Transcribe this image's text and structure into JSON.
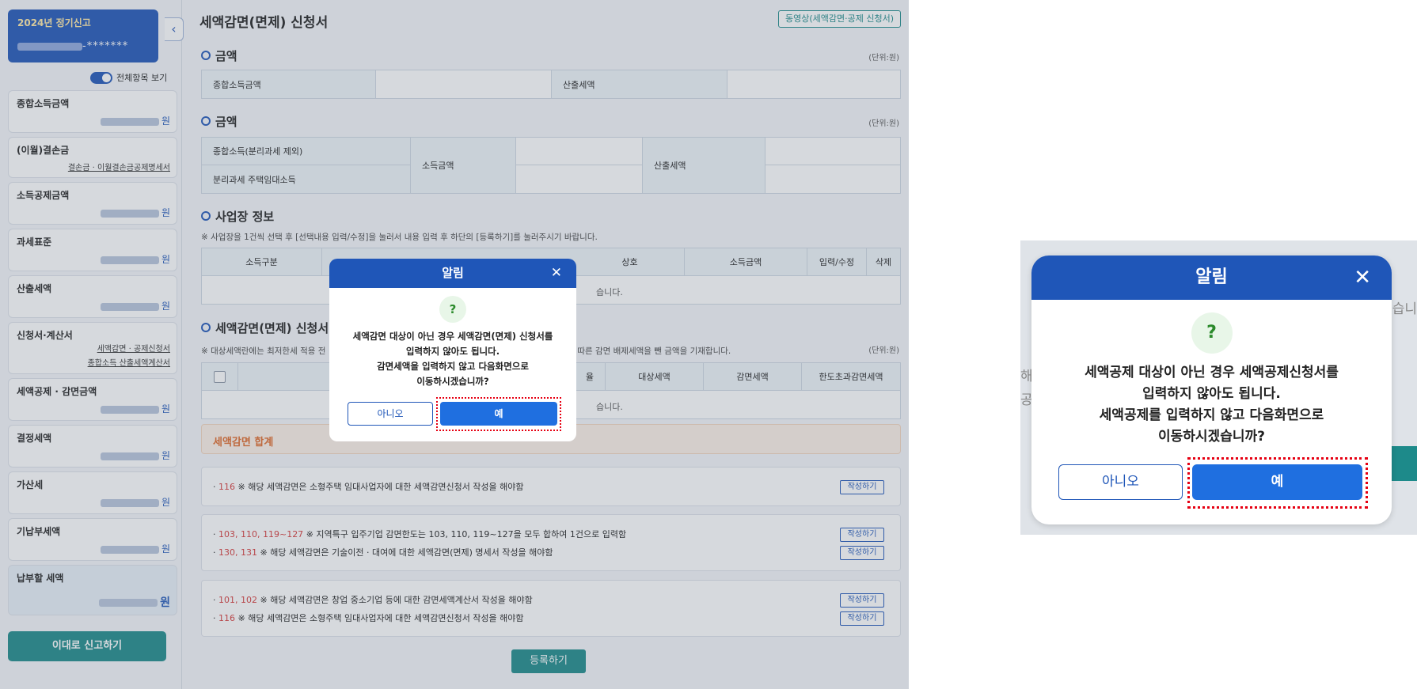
{
  "sidebar": {
    "year_label": "2024년 정기신고",
    "user_id_mask": "-*******",
    "toggle_label": "전체항목 보기",
    "items": [
      {
        "label": "종합소득금액",
        "unit": "원"
      },
      {
        "label": "(이월)결손금",
        "link": "결손금 · 이월결손금공제명세서"
      },
      {
        "label": "소득공제금액",
        "unit": "원"
      },
      {
        "label": "과세표준",
        "unit": "원"
      },
      {
        "label": "산출세액",
        "unit": "원"
      },
      {
        "label": "신청서·계산서",
        "link1": "세액감면 · 공제신청서",
        "link2": "종합소득 산출세액계산서"
      },
      {
        "label": "세액공제 · 감면금액",
        "unit": "원"
      },
      {
        "label": "결정세액",
        "unit": "원"
      },
      {
        "label": "가산세",
        "unit": "원"
      },
      {
        "label": "기납부세액",
        "unit": "원"
      },
      {
        "label": "납부할 세액",
        "unit": "원"
      }
    ],
    "final_button": "이대로 신고하기",
    "collapse_icon": "‹"
  },
  "main": {
    "title": "세액감면(면제) 신청서",
    "video_button": "동영상(세액감면·공제 신청서)",
    "unit_label": "(단위:원)",
    "sec1": {
      "title": "금액",
      "col1": "종합소득금액",
      "col2": "산출세액"
    },
    "sec2": {
      "title": "금액",
      "row1": "종합소득(분리과세 제외)",
      "row2": "분리과세 주택임대소득",
      "col_income": "소득금액",
      "col_tax": "산출세액"
    },
    "sec3": {
      "title": "사업장 정보",
      "note": "※ 사업장을 1건씩 선택 후 [선택내용 입력/수정]을 눌러서 내용 입력 후 하단의 [등록하기]를 눌러주시기 바랍니다.",
      "headers": [
        "소득구분",
        "상호",
        "소득금액",
        "입력/수정",
        "삭제"
      ],
      "empty_tail": "습니다."
    },
    "sec4": {
      "title": "세액감면(면제) 신청서",
      "note_left": "※ 대상세액란에는 최저한세 적용 전",
      "note_right": "적용에 따른 감면 배제세액을 뺀 금액을 기재합니다.",
      "headers": [
        "율",
        "대상세액",
        "감면세액",
        "한도초과감면세액"
      ],
      "empty_tail": "습니다."
    },
    "total_label": "세액감면 합계",
    "write_btn": "작성하기",
    "notices": [
      {
        "code": "116",
        "text": "※ 해당 세액감면은 소형주택 임대사업자에 대한 세액감면신청서 작성을 해야함"
      },
      {
        "code": "103, 110, 119~127",
        "text": "※ 지역특구 입주기업 감면한도는 103, 110, 119~127을 모두 합하여 1건으로 입력함"
      },
      {
        "code": "130, 131",
        "text": "※ 해당 세액감면은 기술이전 · 대여에 대한 세액감면(면제) 명세서 작성을 해야함"
      },
      {
        "code": "101, 102",
        "text": "※ 해당 세액감면은 창업 중소기업 등에 대한 감면세액계산서 작성을 해야함"
      },
      {
        "code": "116",
        "text": "※ 해당 세액감면은 소형주택 임대사업자에 대한 세액감면신청서 작성을 해야함"
      }
    ],
    "register_button": "등록하기"
  },
  "dialog_small": {
    "title": "알림",
    "close_icon": "✕",
    "question_icon": "?",
    "lines": [
      "세액감면 대상이 아닌 경우 세액감면(면제) 신청서를",
      "입력하지 않아도 됩니다.",
      "감면세액을 입력하지 않고 다음화면으로",
      "이동하시겠습니까?"
    ],
    "no": "아니오",
    "yes": "예"
  },
  "dialog_zoom": {
    "title": "알림",
    "close_icon": "✕",
    "question_icon": "?",
    "lines": [
      "세액공제 대상이 아닌 경우 세액공제신청서를",
      "입력하지 않아도 됩니다.",
      "세액공제를 입력하지 않고 다음화면으로",
      "이동하시겠습니까?"
    ],
    "no": "아니오",
    "yes": "예",
    "bg_fragments": [
      "습니",
      "해",
      "공"
    ]
  },
  "colors": {
    "primary": "#1f56b8",
    "yes_button": "#1f6fe0",
    "teal": "#1d8a8a",
    "highlight": "#e60012",
    "code_red": "#d63a3a"
  }
}
